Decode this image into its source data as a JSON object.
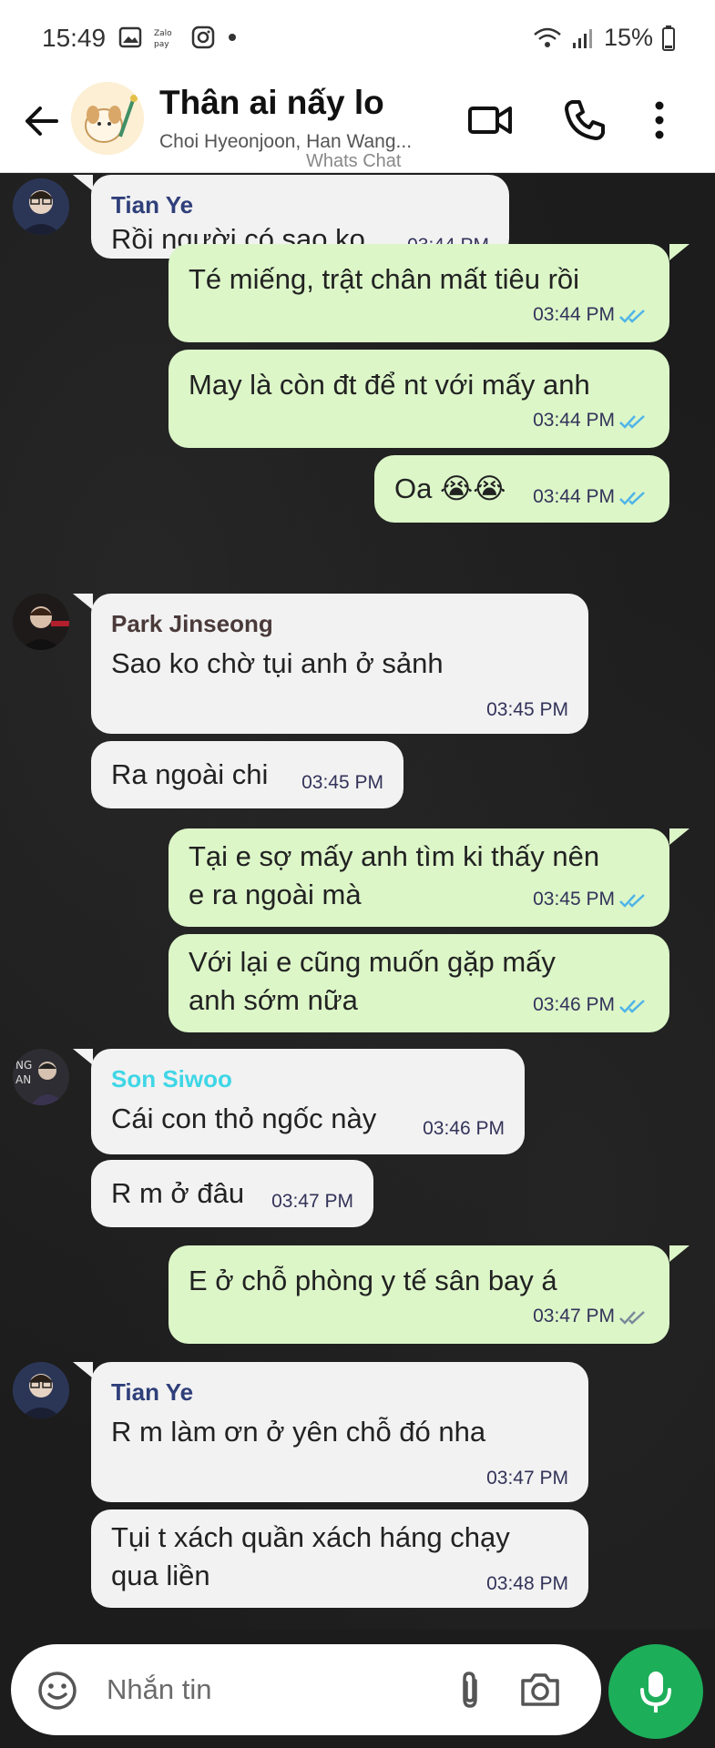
{
  "status_bar": {
    "time": "15:49",
    "battery": "15%"
  },
  "header": {
    "title": "Thân ai nấy lo",
    "subtitle": "Choi Hyeonjoon, Han Wang...",
    "watermark": "Whats Chat"
  },
  "messages": [
    {
      "dir": "in",
      "sender": "Tian Ye",
      "sender_color": "#2f3f7a",
      "text": "Rồi người có sao ko",
      "time": "03:44 PM"
    },
    {
      "dir": "out",
      "text": "Té miếng, trật chân mất tiêu rồi",
      "time": "03:44 PM"
    },
    {
      "dir": "out",
      "text": "May là còn đt để nt với mấy anh",
      "time": "03:44 PM"
    },
    {
      "dir": "out",
      "text": "Oa 😭😭",
      "time": "03:44 PM"
    },
    {
      "dir": "in",
      "sender": "Park Jinseong",
      "sender_color": "#4a3a3a",
      "text": "Sao ko chờ tụi anh ở sảnh",
      "time": "03:45 PM"
    },
    {
      "dir": "in",
      "text": "Ra ngoài chi",
      "time": "03:45 PM"
    },
    {
      "dir": "out",
      "text": "Tại e sợ mấy anh tìm ki thấy nên\ne ra ngoài mà",
      "time": "03:45 PM"
    },
    {
      "dir": "out",
      "text": "Với lại e cũng muốn gặp mấy\nanh sớm nữa",
      "time": "03:46 PM"
    },
    {
      "dir": "in",
      "sender": "Son Siwoo",
      "sender_color": "#3fd6e6",
      "text": "Cái con thỏ ngốc này",
      "time": "03:46 PM"
    },
    {
      "dir": "in",
      "text": "R m ở đâu",
      "time": "03:47 PM"
    },
    {
      "dir": "out",
      "text": "E ở chỗ phòng y tế sân bay á",
      "time": "03:47 PM"
    },
    {
      "dir": "in",
      "sender": "Tian Ye",
      "sender_color": "#2f3f7a",
      "text": "R m làm ơn ở yên chỗ đó nha",
      "time": "03:47 PM"
    },
    {
      "dir": "in",
      "text": "Tụi t xách quần xách háng chạy\nqua liền",
      "time": "03:48 PM"
    }
  ],
  "composer": {
    "placeholder": "Nhắn tin"
  },
  "colors": {
    "out_bubble": "#dcf6c8",
    "in_bubble": "#f2f2f2",
    "mic": "#1dae5a",
    "tick_read": "#4fb4e8"
  },
  "icons": [
    "back-arrow-icon",
    "video-call-icon",
    "phone-icon",
    "more-vert-icon",
    "emoji-icon",
    "attach-icon",
    "camera-icon",
    "mic-icon"
  ]
}
